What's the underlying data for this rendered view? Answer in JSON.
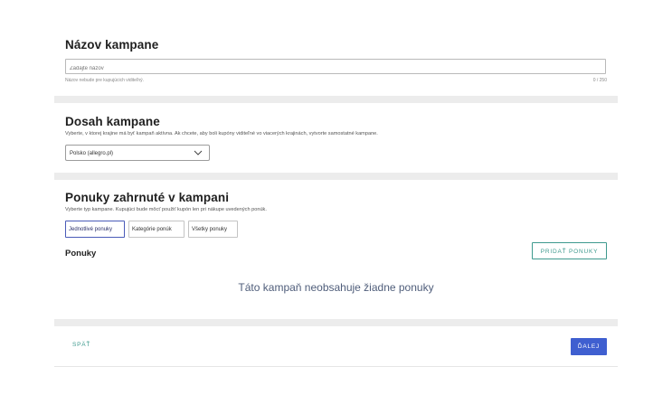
{
  "campaign_name": {
    "title": "Názov kampane",
    "placeholder": "Zadajte názov",
    "hint": "Názov nebude pre kupujúcich viditeľný.",
    "counter": "0 / 250"
  },
  "reach": {
    "title": "Dosah kampane",
    "description": "Vyberte, v ktorej krajine má byť kampaň aktívna. Ak chcete, aby boli kupóny viditeľné vo viacerých krajinách, vytvorte samostatné kampane.",
    "selected_country": "Polsko (allegro.pl)"
  },
  "offers": {
    "title": "Ponuky zahrnuté v kampani",
    "description": "Vyberte typ kampane. Kupujúci bude môcť použiť kupón len pri nákupe uvedených ponúk.",
    "types": [
      {
        "label": "Jednotlivé ponuky",
        "active": true
      },
      {
        "label": "Kategórie ponúk",
        "active": false
      },
      {
        "label": "Všetky ponuky",
        "active": false
      }
    ],
    "list_title": "Ponuky",
    "add_button": "PRIDAŤ PONUKY",
    "empty_message": "Táto kampaň neobsahuje žiadne ponuky"
  },
  "footer": {
    "back_label": "SPÄŤ",
    "next_label": "ĎALEJ"
  },
  "colors": {
    "accent_teal": "#3e9a8e",
    "primary_blue": "#3f5fd0",
    "active_chip_border": "#4a5bb8",
    "separator": "#ececec"
  }
}
